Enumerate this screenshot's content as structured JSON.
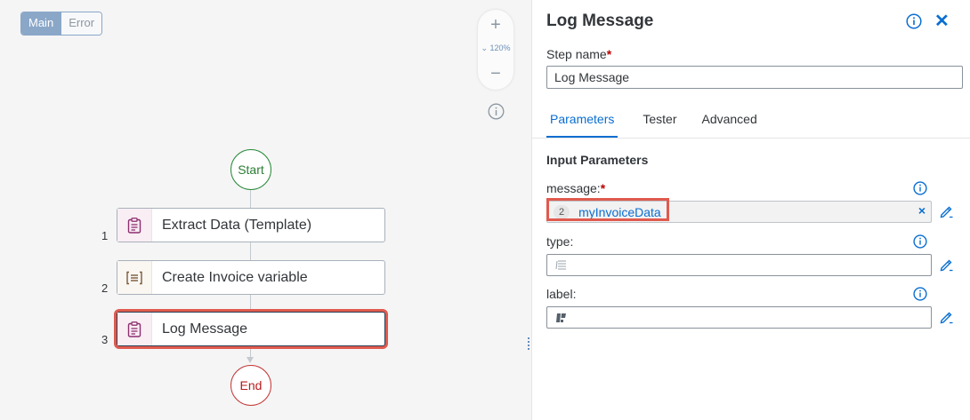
{
  "canvas": {
    "segment": {
      "main": "Main",
      "error": "Error"
    },
    "zoom": {
      "in": "+",
      "level": "120%",
      "out": "−"
    },
    "flow": {
      "start": "Start",
      "end": "End",
      "steps": [
        {
          "num": "1",
          "label": "Extract Data (Template)",
          "icon": "clipboard-icon"
        },
        {
          "num": "2",
          "label": "Create Invoice variable",
          "icon": "list-box-icon"
        },
        {
          "num": "3",
          "label": "Log Message",
          "icon": "clipboard-icon"
        }
      ]
    }
  },
  "panel": {
    "title": "Log Message",
    "step_name_label": "Step name",
    "step_name_value": "Log Message",
    "required_mark": "*",
    "tabs": [
      "Parameters",
      "Tester",
      "Advanced"
    ],
    "section_title": "Input Parameters",
    "params": [
      {
        "label": "message:",
        "required": true,
        "token_number": "2",
        "token_value": "myInvoiceData",
        "clear": "×"
      },
      {
        "label": "type:",
        "required": false
      },
      {
        "label": "label:",
        "required": false
      }
    ]
  },
  "colors": {
    "accent": "#0a6ed1",
    "highlight": "#e05a4e",
    "start": "#2b8a3a",
    "end": "#c43a3a",
    "step_icon_pink": "#8e2e6f"
  }
}
